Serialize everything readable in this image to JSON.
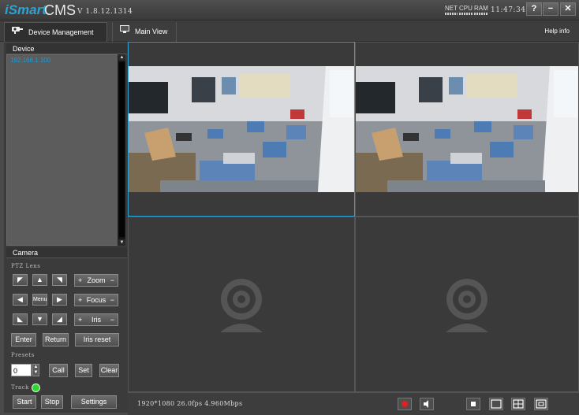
{
  "app": {
    "brand": "iSmart",
    "name": "CMS",
    "version": "V 1.8.12.1314"
  },
  "status": {
    "net": "NET",
    "cpu": "CPU",
    "ram": "RAM",
    "time": "11:47:34"
  },
  "window": {
    "help_glyph": "?",
    "minimize_glyph": "−",
    "close_glyph": "✕"
  },
  "tabs": [
    {
      "label": "Device Management"
    },
    {
      "label": "Main View"
    }
  ],
  "help_label": "Help info",
  "device": {
    "title": "Device",
    "items": [
      {
        "label": "192.168.1.100"
      }
    ]
  },
  "camera": {
    "title": "Camera",
    "ptz_label": "PTZ Lens",
    "menu_label": "Menu",
    "zoom": {
      "label": "Zoom",
      "plus": "+",
      "minus": "−"
    },
    "focus": {
      "label": "Focus",
      "plus": "+",
      "minus": "−"
    },
    "iris": {
      "label": "Iris",
      "plus": "+",
      "minus": "−"
    },
    "enter_label": "Enter",
    "return_label": "Return",
    "iris_reset_label": "Iris reset",
    "presets_label": "Presets",
    "preset_value": "0",
    "call_label": "Call",
    "set_label": "Set",
    "clear_label": "Clear",
    "track_label": "Track",
    "start_label": "Start",
    "stop_label": "Stop",
    "settings_label": "Settings"
  },
  "stream_info": "1920*1080 26.0fps 4.960Mbps",
  "colors": {
    "accent": "#2aa3d6",
    "record": "#e02020",
    "track_on": "#2fd82f"
  }
}
